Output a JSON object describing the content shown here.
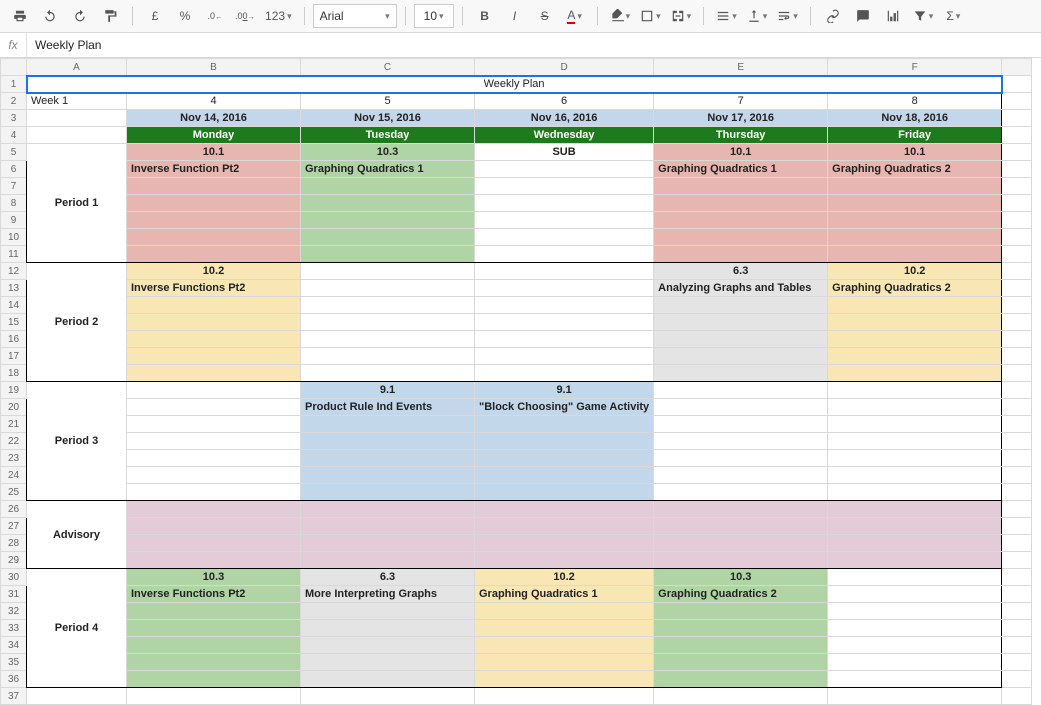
{
  "toolbar": {
    "font_name": "Arial",
    "font_size": "10",
    "pound": "£",
    "percent": "%",
    "dec_dec": ".0←",
    "dec_inc": ".00→",
    "fmt_menu": "123",
    "bold": "B",
    "italic": "I",
    "strike": "S",
    "textcolor": "A",
    "sigma": "Σ"
  },
  "formula_bar": {
    "fx": "fx",
    "value": "Weekly Plan"
  },
  "columns": [
    "A",
    "B",
    "C",
    "D",
    "E",
    "F"
  ],
  "row_headers": [
    "1",
    "2",
    "3",
    "4",
    "5",
    "6",
    "7",
    "8",
    "9",
    "10",
    "11",
    "12",
    "13",
    "14",
    "15",
    "16",
    "17",
    "18",
    "19",
    "20",
    "21",
    "22",
    "23",
    "24",
    "25",
    "26",
    "27",
    "28",
    "29",
    "30",
    "31",
    "32",
    "33",
    "34",
    "35",
    "36",
    "37"
  ],
  "cells": {
    "r1": {
      "title": "Weekly Plan"
    },
    "r2": {
      "a": "Week 1",
      "b": "4",
      "c": "5",
      "d": "6",
      "e": "7",
      "f": "8"
    },
    "r3": {
      "b": "Nov 14, 2016",
      "c": "Nov 15, 2016",
      "d": "Nov 16, 2016",
      "e": "Nov 17, 2016",
      "f": "Nov 18, 2016"
    },
    "r4": {
      "b": "Monday",
      "c": "Tuesday",
      "d": "Wednesday",
      "e": "Thursday",
      "f": "Friday"
    },
    "r5": {
      "b": "10.1",
      "c": "10.3",
      "d": "SUB",
      "e": "10.1",
      "f": "10.1"
    },
    "r6": {
      "b": "Inverse Function Pt2",
      "c": "Graphing Quadratics 1",
      "e": "Graphing Quadratics 1",
      "f": "Graphing Quadratics 2"
    },
    "period1": "Period 1",
    "r12": {
      "b": "10.2",
      "e": "6.3",
      "f": "10.2"
    },
    "r13": {
      "b": "Inverse Functions Pt2",
      "e": "Analyzing Graphs and Tables",
      "f": "Graphing Quadratics 2"
    },
    "period2": "Period 2",
    "r19": {
      "c": "9.1",
      "d": "9.1"
    },
    "r20": {
      "c": "Product Rule Ind Events",
      "d": "\"Block Choosing\" Game Activity"
    },
    "period3": "Period 3",
    "advisory": "Advisory",
    "r30": {
      "b": "10.3",
      "c": "6.3",
      "d": "10.2",
      "e": "10.3"
    },
    "r31": {
      "b": "Inverse Functions Pt2",
      "c": "More Interpreting Graphs",
      "d": "Graphing Quadratics 1",
      "e": "Graphing Quadratics 2"
    },
    "period4": "Period 4"
  }
}
